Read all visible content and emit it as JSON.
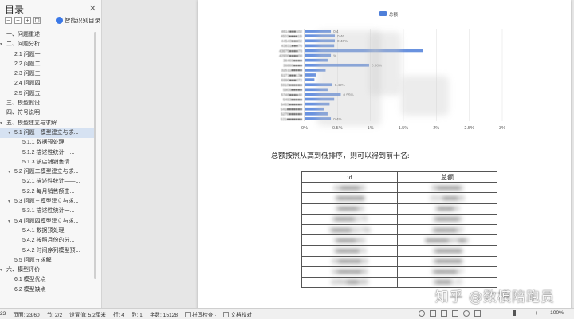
{
  "toc": {
    "title": "目录",
    "close_glyph": "✕",
    "tools": [
      "−",
      "+",
      "+",
      "⊡"
    ],
    "smart_label": "智能识别目录",
    "items": [
      {
        "label": "一、问题重述",
        "level": 1,
        "arrow": ""
      },
      {
        "label": "二、问题分析",
        "level": 1,
        "arrow": "▾"
      },
      {
        "label": "2.1 问题一",
        "level": 2,
        "arrow": ""
      },
      {
        "label": "2.2 问题二",
        "level": 2,
        "arrow": ""
      },
      {
        "label": "2.3 问题三",
        "level": 2,
        "arrow": ""
      },
      {
        "label": "2.4 问题四",
        "level": 2,
        "arrow": ""
      },
      {
        "label": "2.5 问题五",
        "level": 2,
        "arrow": ""
      },
      {
        "label": "三、模型假设",
        "level": 1,
        "arrow": ""
      },
      {
        "label": "四、符号说明",
        "level": 1,
        "arrow": ""
      },
      {
        "label": "五、模型建立与求解",
        "level": 1,
        "arrow": "▾"
      },
      {
        "label": "5.1 问题一模型建立与求...",
        "level": 2,
        "arrow": "▾",
        "active": true
      },
      {
        "label": "5.1.1 数据预处理",
        "level": 3,
        "arrow": ""
      },
      {
        "label": "5.1.2 描述性统计一...",
        "level": 3,
        "arrow": ""
      },
      {
        "label": "5.1.3 该店铺销售情...",
        "level": 3,
        "arrow": ""
      },
      {
        "label": "5.2 问题二模型建立与求...",
        "level": 2,
        "arrow": "▾"
      },
      {
        "label": "5.2.1 描述性统计——...",
        "level": 3,
        "arrow": ""
      },
      {
        "label": "5.2.2 每月销售额曲...",
        "level": 3,
        "arrow": ""
      },
      {
        "label": "5.3 问题三模型建立与求...",
        "level": 2,
        "arrow": "▾"
      },
      {
        "label": "5.3.1 描述性统计一...",
        "level": 3,
        "arrow": ""
      },
      {
        "label": "5.4 问题四模型建立与求...",
        "level": 2,
        "arrow": "▾"
      },
      {
        "label": "5.4.1 数据预处理",
        "level": 3,
        "arrow": ""
      },
      {
        "label": "5.4.2 按照月份的分...",
        "level": 3,
        "arrow": ""
      },
      {
        "label": "5.4.2 时间序列模型预...",
        "level": 3,
        "arrow": ""
      },
      {
        "label": "5.5 问题五求解",
        "level": 2,
        "arrow": ""
      },
      {
        "label": "六、模型评价",
        "level": 1,
        "arrow": "▾"
      },
      {
        "label": "6.1 模型优点",
        "level": 2,
        "arrow": ""
      },
      {
        "label": "6.2 模型缺点",
        "level": 2,
        "arrow": ""
      }
    ]
  },
  "document": {
    "caption": "总额按照从高到低排序，则可以得到前十名:",
    "table": {
      "headers": [
        "id",
        "总额"
      ],
      "rows": [
        [
          "41■■■■■45",
          "39■■■■■■2"
        ],
        [
          "4■■■■■■■",
          "2521■■■■26"
        ],
        [
          "2■■■■■43",
          "2■■■■65"
        ],
        [
          "4■■■■■2178",
          "2■■■■■■9"
        ],
        [
          "5■■■■■321766",
          "1■■■■■■37"
        ],
        [
          "5■■■■■402",
          "■■■■■■507■■1"
        ],
        [
          "3■■■■■■74",
          "1■■■■■■■"
        ],
        [
          "45■■■■■■34",
          "1■■■■■■■"
        ],
        [
          "34■■■■■■96",
          "1■■■■■■17"
        ],
        [
          "42966■■■480",
          "1■■■■2.15"
        ]
      ]
    },
    "watermark": "知乎 @数模陪跑员"
  },
  "chart_data": {
    "type": "bar",
    "orientation": "horizontal",
    "legend": [
      "总额"
    ],
    "legend_position": "top-center",
    "series_color": "#4f7fd9",
    "x_ticks": [
      "0%",
      "0.5%",
      "1%",
      "1.5%",
      "2%",
      "2.5%",
      "3%"
    ],
    "xlim": [
      0,
      3
    ],
    "categories": [
      "4614■■■102",
      "4503■■■■1B",
      "44540■■■02",
      "43831■■■76",
      "43675■■■■78",
      "42900■■■■08",
      "38469■■■■",
      "36888■■■■",
      "32511■■■■■",
      "6171■■■13■",
      "6990■■■072",
      "5910■■■■■■",
      "5906■■■■■",
      "5746■■■■48",
      "5493■■■■■",
      "5463■■■■■■",
      "541■■■■■■■",
      "5278■■■■■■",
      "521■■■■■■■"
    ],
    "values": [
      0.4,
      0.46,
      0.46,
      0.45,
      1.8,
      0.4,
      0.35,
      0.98,
      0.32,
      0.18,
      0.15,
      0.42,
      0.35,
      0.55,
      0.45,
      0.38,
      0.3,
      0.35,
      0.4
    ],
    "data_labels": [
      "0.4",
      "0.46",
      "0.46%",
      "",
      "",
      "%",
      "",
      "0.98%",
      "",
      "",
      "",
      "0.42%",
      "",
      "0.55%",
      "",
      "",
      "",
      "",
      "0.4%"
    ]
  },
  "status": {
    "page_short": "23",
    "page": "页面: 23/60",
    "section": "节: 2/2",
    "setting": "设置值: 5.2厘米",
    "row": "行: 4",
    "col": "列: 1",
    "words": "字数: 15128",
    "spell": "拼写检查 ·",
    "proof": "文档校对",
    "zoom": "100%"
  },
  "colors": {
    "accent": "#3b78e7",
    "active_item": "#d6e2f2",
    "bar": "#4f7fd9"
  }
}
